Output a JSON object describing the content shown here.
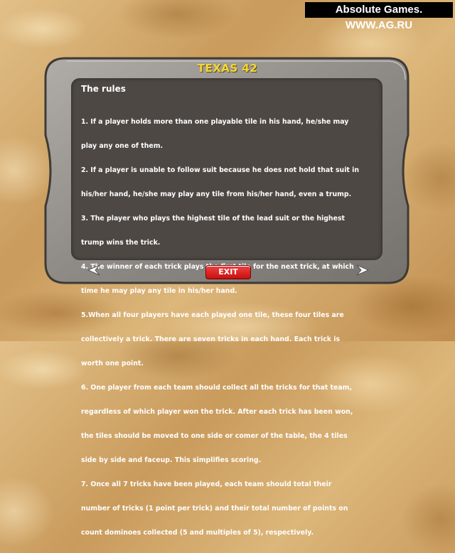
{
  "watermark": "Absolute Games. WWW.AG.RU",
  "title": "TEXAS 42",
  "rules": {
    "heading": "The rules",
    "lines": [
      "1. If a player holds more than one playable tile in his hand, he/she may",
      "play any one of them.",
      "2. If a player is unable to follow suit because he does not hold that suit in",
      "his/her hand, he/she may play any tile from his/her hand, even a trump.",
      "3. The player who plays the highest tile of the lead suit or the highest",
      "trump wins the trick.",
      "4. The winner of each trick plays the first tile for the next trick, at which",
      "time he may play any tile in his/her hand.",
      "5.When all four players have each played one tile, these four tiles are",
      "collectively a trick. There are seven tricks in each hand. Each trick is",
      "worth one point.",
      "6. One player from each team should collect all the tricks for that team,",
      "regardless of which player won the trick. After each trick has been won,",
      "the tiles should be moved to one side or comer of the table, the 4 tiles",
      "side by side and faceup. This simplifies scoring.",
      "7. Once all 7 tricks have been played, each team should total their",
      "number of tricks (1 point per trick) and their total number of points on",
      "count dominoes collected (5 and multiples of 5), respectively."
    ]
  },
  "buttons": {
    "exit": "EXIT",
    "prev_icon": "arrow-left-icon",
    "next_icon": "arrow-right-icon"
  },
  "colors": {
    "title": "#f4d63a",
    "text_box": "#4e4844",
    "frame": "#8d8a86",
    "exit": "#e02020"
  }
}
